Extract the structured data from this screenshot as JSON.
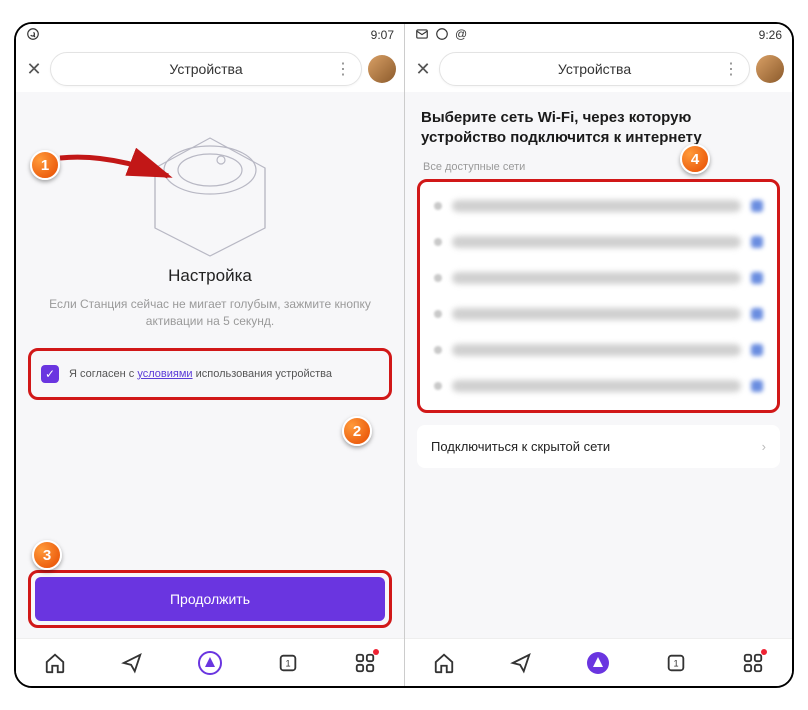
{
  "left": {
    "statusbar": {
      "time": "9:07"
    },
    "header": {
      "title": "Устройства"
    },
    "setup": {
      "title": "Настройка",
      "subtitle": "Если Станция сейчас не мигает голубым, зажмите кнопку активации на 5 секунд."
    },
    "consent": {
      "prefix": "Я согласен с ",
      "link": "условиями",
      "suffix": " использования устройства"
    },
    "continue_label": "Продолжить"
  },
  "right": {
    "statusbar": {
      "time": "9:26"
    },
    "header": {
      "title": "Устройства"
    },
    "wifi_heading": "Выберите сеть Wi-Fi, через которую устройство подключится к интернету",
    "networks_label": "Все доступные сети",
    "hidden_network_label": "Подключиться к скрытой сети"
  },
  "badges": {
    "b1": "1",
    "b2": "2",
    "b3": "3",
    "b4": "4"
  }
}
